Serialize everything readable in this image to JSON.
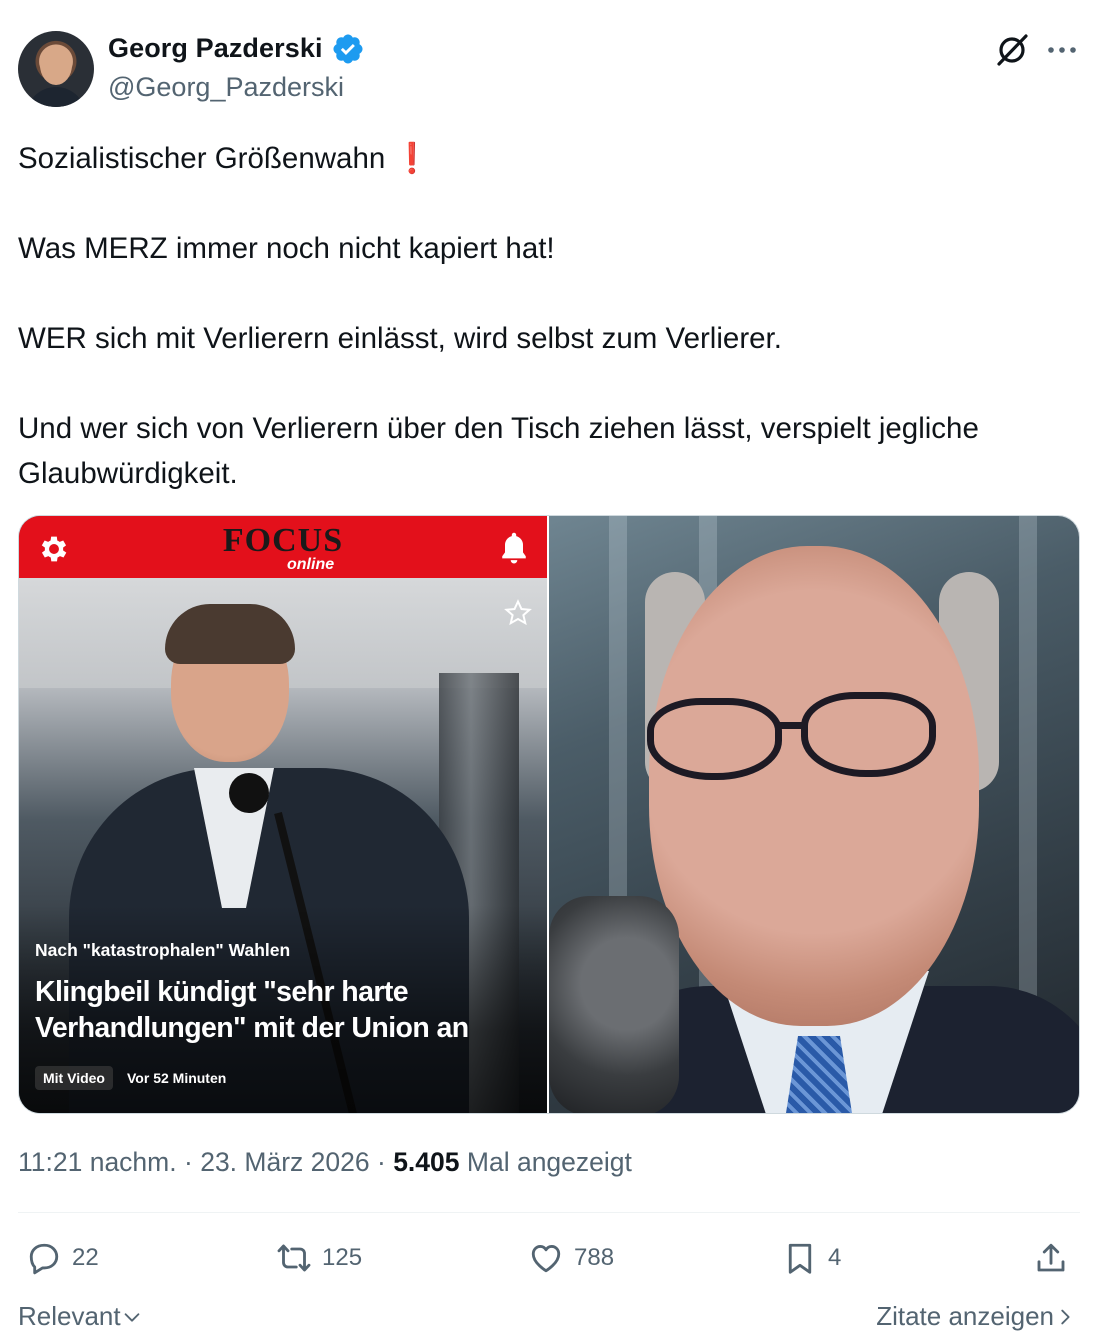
{
  "author": {
    "name": "Georg Pazderski",
    "handle": "@Georg_Pazderski",
    "verified": true,
    "verified_color": "#1d9bf0"
  },
  "tweet": {
    "lines": [
      "Sozialistischer Größenwahn",
      "Was MERZ immer noch nicht kapiert hat!",
      "WER sich mit Verlierern einlässt, wird selbst zum Verlierer.",
      "Und wer sich von Verlierern über den Tisch ziehen lässt, verspielt jegliche Glaubwürdigkeit."
    ],
    "emoji": "❗"
  },
  "media": {
    "left": {
      "logo": "FOCUS",
      "logo_sub": "online",
      "kicker": "Nach \"katastrophalen\" Wahlen",
      "headline": "Klingbeil kündigt \"sehr harte Verhandlungen\" mit der Union an",
      "pill_video": "Mit Video",
      "pill_time": "Vor 52 Minuten",
      "bar_color": "#e3101b"
    }
  },
  "meta": {
    "time": "11:21 nachm.",
    "date": "23. März 2026",
    "views_count": "5.405",
    "views_label": "Mal angezeigt",
    "separator": "·"
  },
  "actions": {
    "replies": "22",
    "retweets": "125",
    "likes": "788",
    "bookmarks": "4"
  },
  "footer": {
    "sort_label": "Relevant",
    "quotes_label": "Zitate anzeigen"
  },
  "icons": [
    "verified-badge-icon",
    "grok-icon",
    "more-icon",
    "gear-icon",
    "bell-icon",
    "star-icon",
    "reply-icon",
    "retweet-icon",
    "like-icon",
    "bookmark-icon",
    "share-icon",
    "chevron-down-icon",
    "chevron-right-icon"
  ]
}
